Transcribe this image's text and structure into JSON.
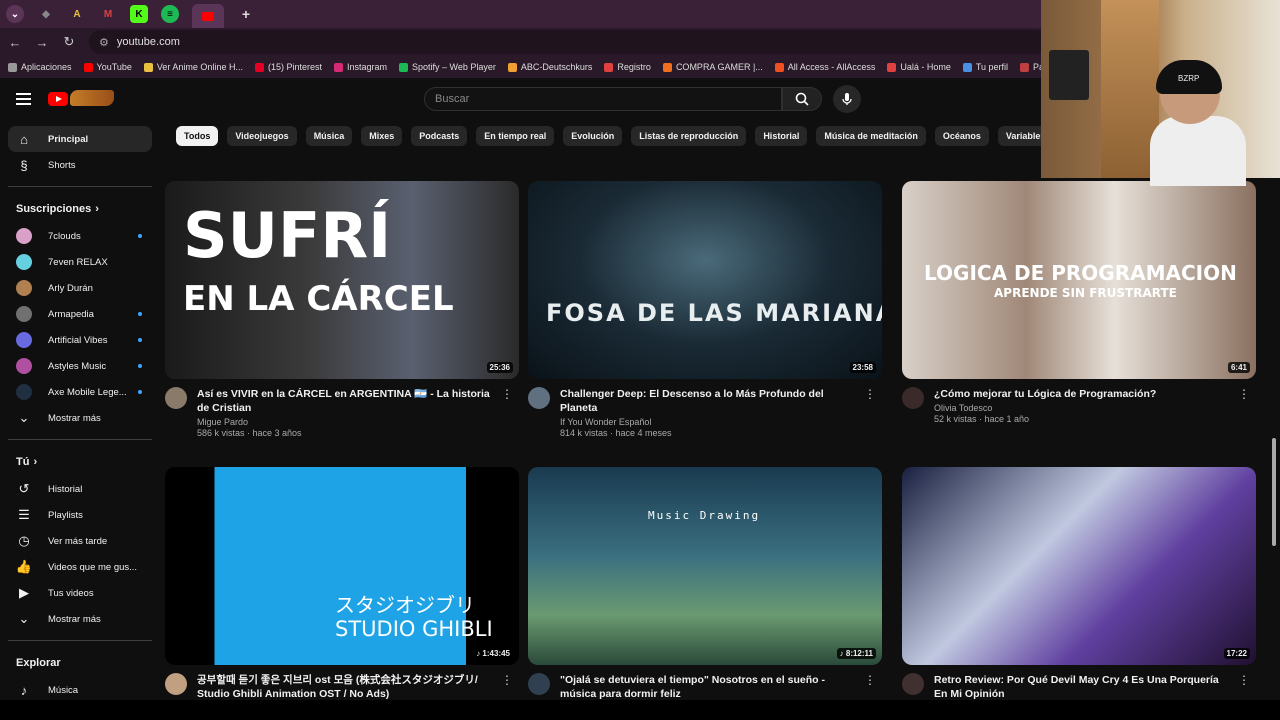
{
  "browser": {
    "url": "youtube.com",
    "bookmarks": [
      "Aplicaciones",
      "YouTube",
      "Ver Anime Online H...",
      "(15) Pinterest",
      "Instagram",
      "Spotify – Web Player",
      "ABC-Deutschkurs",
      "Registro",
      "COMPRA GAMER |...",
      "All Access - AllAccess",
      "Ualá - Home",
      "Tu perfil",
      "Panel – academi"
    ],
    "tab_icons": [
      "chevron-down-icon",
      "tab-icon",
      "anime-tab-icon",
      "gmail-tab-icon",
      "kick-tab-icon",
      "spotify-tab-icon",
      "youtube-tab-icon"
    ]
  },
  "topbar": {
    "search_placeholder": "Buscar"
  },
  "chips": [
    "Todos",
    "Videojuegos",
    "Música",
    "Mixes",
    "Podcasts",
    "En tiempo real",
    "Evolución",
    "Listas de reproducción",
    "Historial",
    "Música de meditación",
    "Océanos",
    "Variables (Mat"
  ],
  "sidebar": {
    "main": [
      {
        "label": "Principal",
        "icon": "home-icon"
      },
      {
        "label": "Shorts",
        "icon": "shorts-icon"
      }
    ],
    "subs_title": "Suscripciones",
    "subs": [
      {
        "label": "7clouds",
        "color": "#d9a0c8",
        "dot": true
      },
      {
        "label": "7even RELAX",
        "color": "#66d0e0",
        "dot": false
      },
      {
        "label": "Arly Durán",
        "color": "#b08050",
        "dot": false
      },
      {
        "label": "Armapedia",
        "color": "#707070",
        "dot": true
      },
      {
        "label": "Artificial Vibes",
        "color": "#6a6ae0",
        "dot": true
      },
      {
        "label": "Astyles Music",
        "color": "#b050a0",
        "dot": true
      },
      {
        "label": "Axe Mobile Lege...",
        "color": "#203040",
        "dot": true
      }
    ],
    "subs_more": "Mostrar más",
    "you_title": "Tú",
    "you": [
      {
        "label": "Historial",
        "icon": "history-icon"
      },
      {
        "label": "Playlists",
        "icon": "playlists-icon"
      },
      {
        "label": "Ver más tarde",
        "icon": "watch-later-icon"
      },
      {
        "label": "Videos que me gus...",
        "icon": "like-icon"
      },
      {
        "label": "Tus videos",
        "icon": "your-videos-icon"
      }
    ],
    "you_more": "Mostrar más",
    "explore_title": "Explorar",
    "explore": [
      {
        "label": "Música",
        "icon": "music-icon"
      }
    ]
  },
  "videos": [
    {
      "title": "Así es VIVIR en la CÁRCEL en ARGENTINA 🇦🇷 - La historia de Cristian",
      "channel": "Migue Pardo",
      "stats": "586 k vistas · hace 3 años",
      "duration": "25:36",
      "thumb_text": [
        "SUFRÍ",
        "EN LA CÁRCEL"
      ]
    },
    {
      "title": "Challenger Deep: El Descenso a lo Más Profundo del Planeta",
      "channel": "If You Wonder Español",
      "stats": "814 k vistas · hace 4 meses",
      "duration": "23:58",
      "thumb_text": [
        "FOSA DE LAS MARIANAS"
      ]
    },
    {
      "title": "¿Cómo mejorar tu Lógica de Programación?",
      "channel": "Olivia Todesco",
      "stats": "52 k vistas · hace 1 año",
      "duration": "6:41",
      "thumb_text": [
        "LOGICA DE PROGRAMACION",
        "APRENDE SIN FRUSTRARTE"
      ]
    },
    {
      "title": "공부할때 듣기 좋은 지브리 ost 모음 (株式会社スタジオジブリ/ Studio Ghibli Animation OST / No Ads)",
      "channel": "",
      "stats": "",
      "duration": "♪ 1:43:45",
      "thumb_text": [
        "スタジオジブリ",
        "STUDIO GHIBLI"
      ]
    },
    {
      "title": "\"Ojalá se detuviera el tiempo\" Nosotros en el sueño - música para dormir feliz",
      "channel": "",
      "stats": "",
      "duration": "♪ 8:12:11",
      "thumb_text": [
        "Music Drawing"
      ]
    },
    {
      "title": "Retro Review: Por Qué Devil May Cry 4 Es Una Porquería En Mi Opinión",
      "channel": "",
      "stats": "",
      "duration": "17:22",
      "thumb_text": []
    }
  ],
  "webcam": {
    "cap_text": "BZRP"
  }
}
